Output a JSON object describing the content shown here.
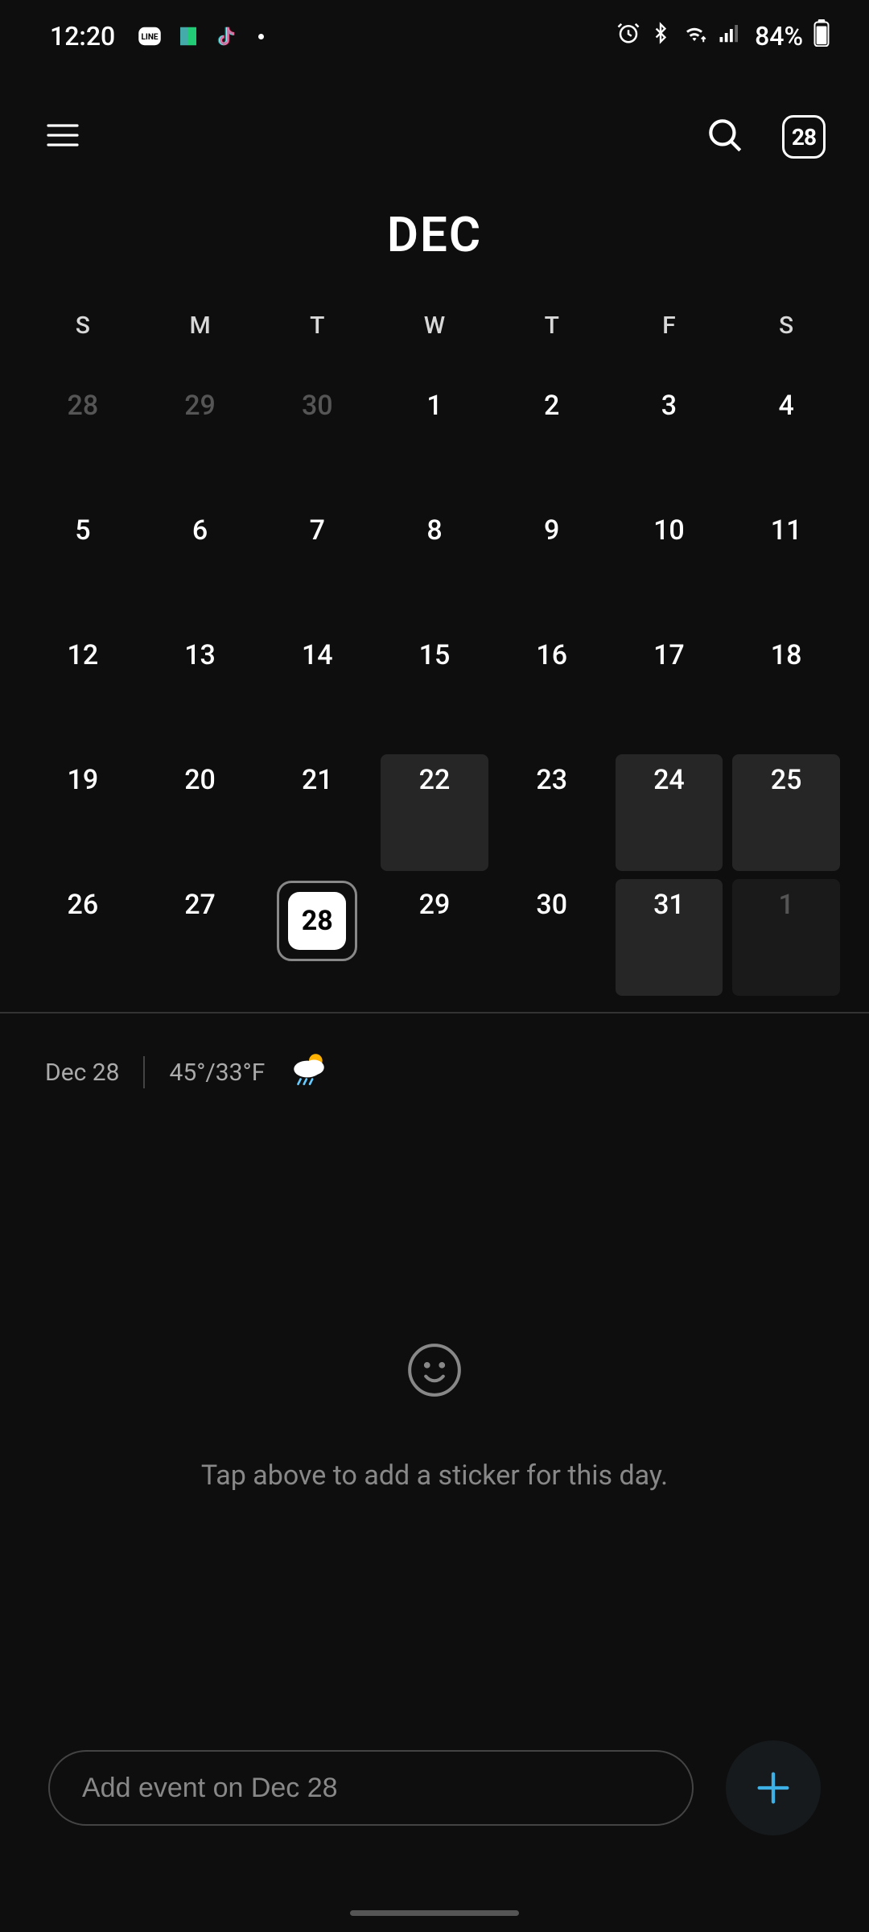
{
  "status": {
    "time": "12:20",
    "battery": "84%"
  },
  "appbar": {
    "today_badge": "28"
  },
  "month": {
    "title": "DEC",
    "weekdays": [
      "S",
      "M",
      "T",
      "W",
      "T",
      "F",
      "S"
    ],
    "weeks": [
      [
        {
          "n": "28",
          "type": "prev"
        },
        {
          "n": "29",
          "type": "prev"
        },
        {
          "n": "30",
          "type": "prev"
        },
        {
          "n": "1",
          "type": "cur"
        },
        {
          "n": "2",
          "type": "cur"
        },
        {
          "n": "3",
          "type": "cur"
        },
        {
          "n": "4",
          "type": "cur"
        }
      ],
      [
        {
          "n": "5",
          "type": "cur"
        },
        {
          "n": "6",
          "type": "cur"
        },
        {
          "n": "7",
          "type": "cur"
        },
        {
          "n": "8",
          "type": "cur"
        },
        {
          "n": "9",
          "type": "cur"
        },
        {
          "n": "10",
          "type": "cur"
        },
        {
          "n": "11",
          "type": "cur"
        }
      ],
      [
        {
          "n": "12",
          "type": "cur"
        },
        {
          "n": "13",
          "type": "cur"
        },
        {
          "n": "14",
          "type": "cur"
        },
        {
          "n": "15",
          "type": "cur"
        },
        {
          "n": "16",
          "type": "cur"
        },
        {
          "n": "17",
          "type": "cur"
        },
        {
          "n": "18",
          "type": "cur"
        }
      ],
      [
        {
          "n": "19",
          "type": "cur"
        },
        {
          "n": "20",
          "type": "cur"
        },
        {
          "n": "21",
          "type": "cur"
        },
        {
          "n": "22",
          "type": "cur",
          "shade": true
        },
        {
          "n": "23",
          "type": "cur"
        },
        {
          "n": "24",
          "type": "cur",
          "shade": true
        },
        {
          "n": "25",
          "type": "cur",
          "shade": true
        }
      ],
      [
        {
          "n": "26",
          "type": "cur"
        },
        {
          "n": "27",
          "type": "cur"
        },
        {
          "n": "28",
          "type": "cur",
          "today": true
        },
        {
          "n": "29",
          "type": "cur"
        },
        {
          "n": "30",
          "type": "cur"
        },
        {
          "n": "31",
          "type": "cur",
          "shade": true
        },
        {
          "n": "1",
          "type": "next",
          "shadeDim": true
        }
      ]
    ]
  },
  "weather": {
    "date": "Dec 28",
    "temp": "45°/33°F"
  },
  "empty": {
    "hint": "Tap above to add a sticker for this day."
  },
  "input": {
    "placeholder": "Add event on Dec 28"
  }
}
